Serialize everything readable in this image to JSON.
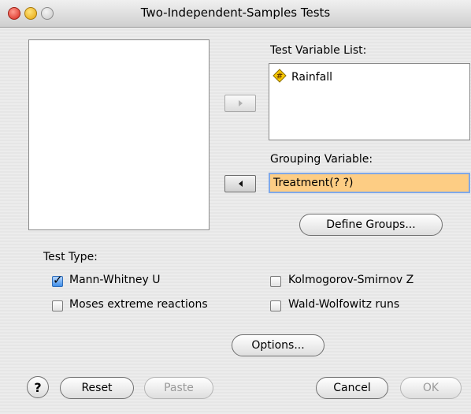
{
  "window": {
    "title": "Two-Independent-Samples Tests"
  },
  "source_list": {
    "items": []
  },
  "test_variable_list": {
    "label": "Test Variable List:",
    "items": [
      {
        "name": "Rainfall",
        "icon": "scale-variable-icon"
      }
    ]
  },
  "grouping_variable": {
    "label": "Grouping Variable:",
    "value": "Treatment(? ?)",
    "highlight_color": "#fdcd84"
  },
  "buttons": {
    "define_groups": "Define Groups...",
    "options": "Options...",
    "reset": "Reset",
    "paste": "Paste",
    "cancel": "Cancel",
    "ok": "OK",
    "help": "?"
  },
  "test_type": {
    "label": "Test Type:",
    "options": [
      {
        "label": "Mann-Whitney U",
        "checked": true
      },
      {
        "label": "Kolmogorov-Smirnov Z",
        "checked": false
      },
      {
        "label": "Moses extreme reactions",
        "checked": false
      },
      {
        "label": "Wald-Wolfowitz runs",
        "checked": false
      }
    ]
  }
}
